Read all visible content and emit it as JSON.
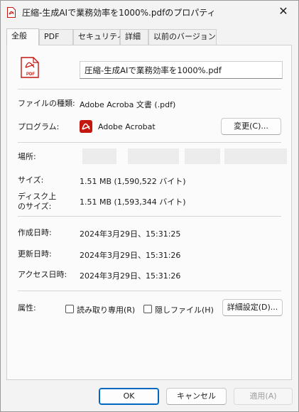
{
  "window": {
    "title": "圧縮-生成AIで業務効率を1000%.pdfのプロパティ",
    "close_glyph": "✕"
  },
  "tabs": [
    {
      "label": "全般",
      "active": true
    },
    {
      "label": "PDF",
      "active": false
    },
    {
      "label": "セキュリティ",
      "active": false
    },
    {
      "label": "詳細",
      "active": false
    },
    {
      "label": "以前のバージョン",
      "active": false
    }
  ],
  "general": {
    "file_icon": "pdf-file-icon",
    "filename": "圧縮-生成AIで業務効率を1000%.pdf",
    "file_type_label": "ファイルの種類:",
    "file_type_value": "Adobe Acroba 文書 (.pdf)",
    "program_label": "プログラム:",
    "program_icon": "adobe-acrobat-icon",
    "program_value": "Adobe Acrobat",
    "change_button": "変更(C)...",
    "location_label": "場所:",
    "size_label": "サイズ:",
    "size_value": "1.51 MB (1,590,522 バイト)",
    "disk_size_label_line1": "ディスク上",
    "disk_size_label_line2": "のサイズ:",
    "disk_size_value": "1.51 MB (1,593,344 バイト)",
    "created_label": "作成日時:",
    "created_value": "2024年3月29日、15:31:25",
    "modified_label": "更新日時:",
    "modified_value": "2024年3月29日、15:31:26",
    "accessed_label": "アクセス日時:",
    "accessed_value": "2024年3月29日、15:31:26",
    "attributes_label": "属性:",
    "readonly_label": "読み取り専用(R)",
    "readonly_checked": false,
    "hidden_label": "隠しファイル(H)",
    "hidden_checked": false,
    "advanced_button": "詳細設定(D)..."
  },
  "footer": {
    "ok": "OK",
    "cancel": "キャンセル",
    "apply": "適用(A)"
  },
  "colors": {
    "accent": "#0067c0",
    "pdf_red": "#c4170f"
  }
}
